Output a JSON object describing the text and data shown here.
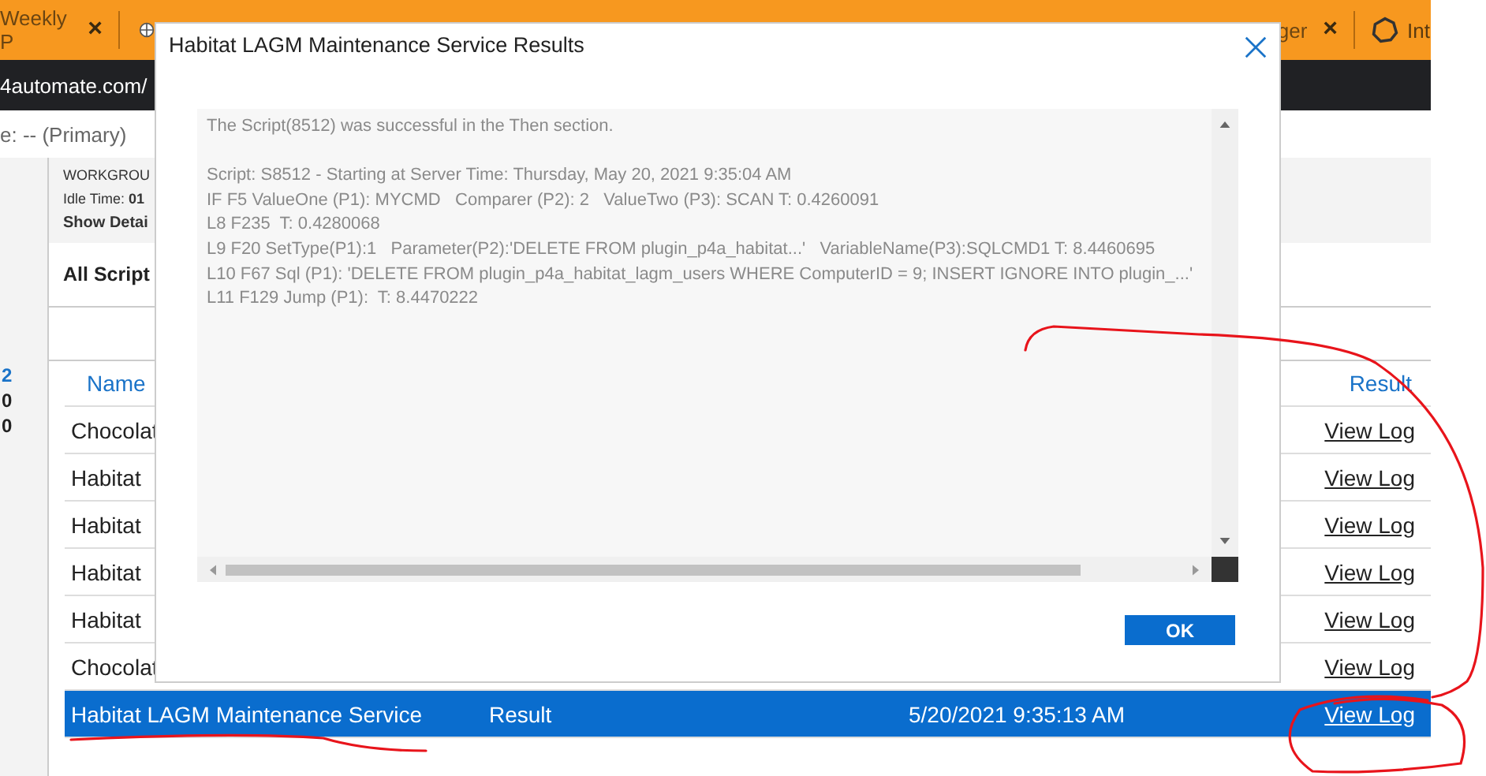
{
  "browser": {
    "tabs": [
      {
        "label": "Weekly P",
        "close": "×"
      },
      {
        "label": "ger",
        "close": "×"
      },
      {
        "label": "Int"
      }
    ],
    "address": "4automate.com/"
  },
  "page": {
    "breadcrumb": "e: -- (Primary)",
    "info": [
      "WORKGROU",
      "Idle Time: **01**"
    ],
    "show_details": "Show Detai",
    "side_numbers": [
      {
        "text": "2",
        "color": "#1a73c8"
      },
      {
        "text": "0",
        "color": "#222222"
      },
      {
        "text": "0",
        "color": "#222222"
      }
    ],
    "card_title": "All Script",
    "table": {
      "columns": [
        "Name",
        "Result"
      ],
      "rows": [
        {
          "name": "Chocolat",
          "result": "View Log",
          "selected": false
        },
        {
          "name": "Habitat",
          "result": "View Log",
          "selected": false
        },
        {
          "name": "Habitat",
          "result": "View Log",
          "selected": false
        },
        {
          "name": "Habitat",
          "result": "View Log",
          "selected": false
        },
        {
          "name": "Habitat",
          "result": "View Log",
          "selected": false
        },
        {
          "name": "Chocolat",
          "result": "View Log",
          "selected": false
        },
        {
          "name": "Habitat LAGM Maintenance Service",
          "column_2": "Result",
          "column_3": "5/20/2021 9:35:13 AM",
          "result": "View Log",
          "selected": true
        }
      ]
    }
  },
  "dialog": {
    "title": "Habitat LAGM Maintenance Service Results",
    "summary": "The Script(8512) was successful in the Then section.",
    "lines": [
      "Script: S8512 - Starting at Server Time: Thursday, May 20, 2021 9:35:04 AM",
      "IF F5 ValueOne (P1): MYCMD   Comparer (P2): 2   ValueTwo (P3): SCAN T: 0.4260091",
      "L8 F235  T: 0.4280068",
      "L9 F20 SetType(P1):1   Parameter(P2):'DELETE FROM plugin_p4a_habitat...'   VariableName(P3):SQLCMD1 T: 8.4460695",
      "L10 F67 Sql (P1): 'DELETE FROM plugin_p4a_habitat_lagm_users WHERE ComputerID = 9; INSERT IGNORE INTO plugin_...'",
      "L11 F129 Jump (P1):  T: 8.4470222"
    ],
    "ok": "OK"
  }
}
